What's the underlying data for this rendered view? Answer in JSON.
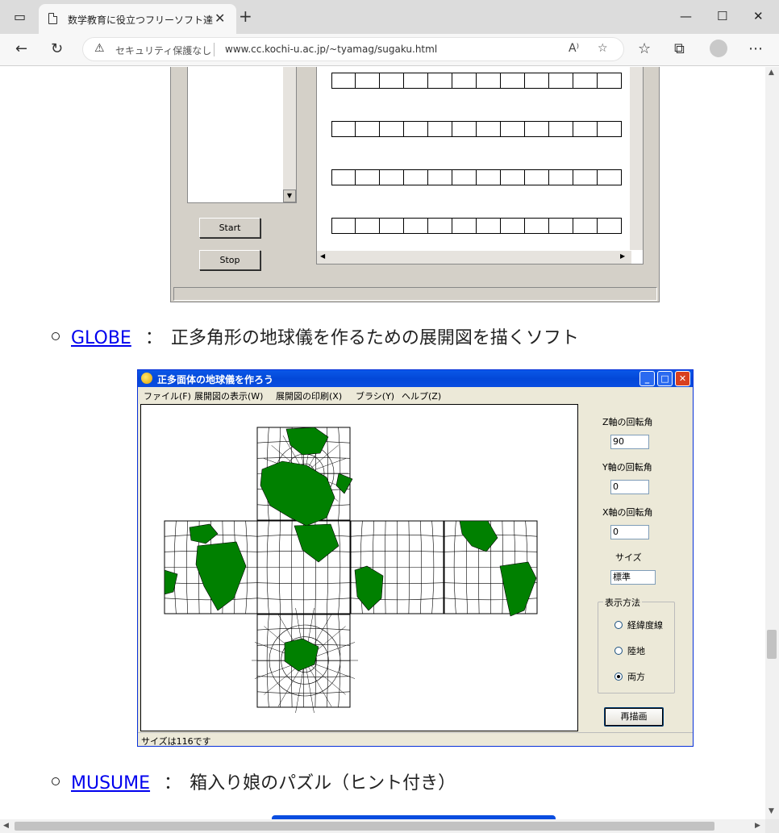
{
  "browser": {
    "tab_title": "数学教育に役立つフリーソフト達",
    "security_label": "セキュリティ保護なし",
    "url": "www.cc.kochi-u.ac.jp/~tyamag/sugaku.html"
  },
  "shot1": {
    "start_label": "Start",
    "stop_label": "Stop"
  },
  "items": [
    {
      "link": "GLOBE",
      "sep": "：",
      "desc": "正多角形の地球儀を作るための展開図を描くソフト"
    },
    {
      "link": "MUSUME",
      "sep": "：",
      "desc": "箱入り娘のパズル（ヒント付き）"
    }
  ],
  "globe_app": {
    "title": "正多面体の地球儀を作ろう",
    "menu": [
      "ファイル(F)",
      "展開図の表示(W)",
      "展開図の印刷(X)",
      "ブラシ(Y)",
      "ヘルプ(Z)"
    ],
    "z_label": "Z軸の回転角",
    "z_value": "90",
    "y_label": "Y軸の回転角",
    "y_value": "0",
    "x_label": "X軸の回転角",
    "x_value": "0",
    "size_label": "サイズ",
    "size_value": "標準",
    "display_label": "表示方法",
    "radios": [
      {
        "label": "経緯度線",
        "selected": false
      },
      {
        "label": "陸地",
        "selected": false
      },
      {
        "label": "両方",
        "selected": true
      }
    ],
    "redraw_label": "再描画",
    "status": "サイズは116です",
    "land_color": "#008000"
  }
}
